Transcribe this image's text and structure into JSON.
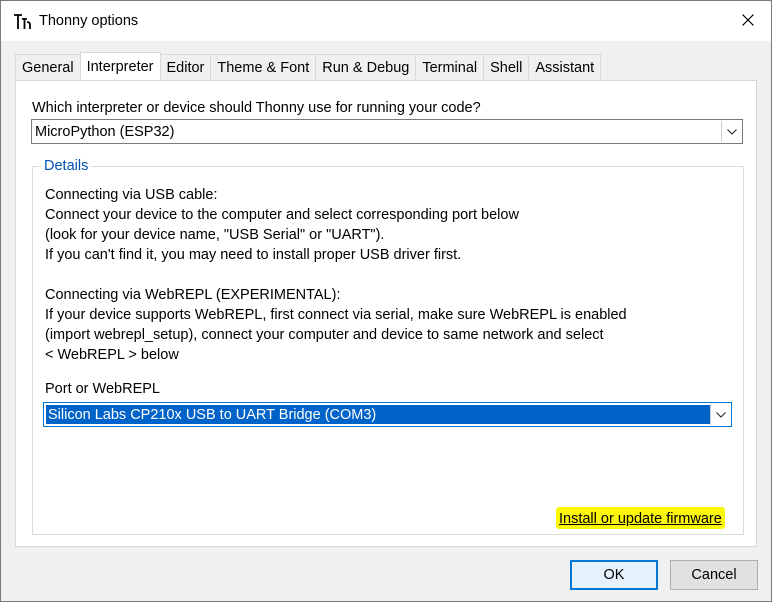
{
  "window": {
    "title": "Thonny options",
    "close_symbol": "✕"
  },
  "icons": {
    "app": "thonny-logo-icon",
    "close": "close-icon",
    "dropdown": "chevron-down-icon"
  },
  "tabs": [
    {
      "label": "General",
      "active": false
    },
    {
      "label": "Interpreter",
      "active": true
    },
    {
      "label": "Editor",
      "active": false
    },
    {
      "label": "Theme & Font",
      "active": false
    },
    {
      "label": "Run & Debug",
      "active": false
    },
    {
      "label": "Terminal",
      "active": false
    },
    {
      "label": "Shell",
      "active": false
    },
    {
      "label": "Assistant",
      "active": false
    }
  ],
  "interpreter": {
    "question": "Which interpreter or device should Thonny use for running your code?",
    "selected": "MicroPython (ESP32)"
  },
  "details": {
    "legend": "Details",
    "usb_lines": [
      "Connecting via USB cable:",
      "Connect your device to the computer and select corresponding port below",
      "(look for your device name, \"USB Serial\" or \"UART\").",
      "If you can't find it, you may need to install proper USB driver first."
    ],
    "webrepl_lines": [
      "Connecting via WebREPL (EXPERIMENTAL):",
      "If your device supports WebREPL, first connect via serial, make sure WebREPL is enabled",
      "(import webrepl_setup), connect your computer and device to same network and select",
      "< WebREPL > below"
    ],
    "port_label": "Port or WebREPL",
    "port_selected": "Silicon Labs CP210x USB to UART Bridge (COM3)",
    "firmware_link": "Install or update firmware",
    "highlight_color": "#fcf60a"
  },
  "buttons": {
    "ok": "OK",
    "cancel": "Cancel"
  },
  "colors": {
    "accent": "#0078d7",
    "selection": "#0063c9",
    "legend": "#0050b3"
  }
}
